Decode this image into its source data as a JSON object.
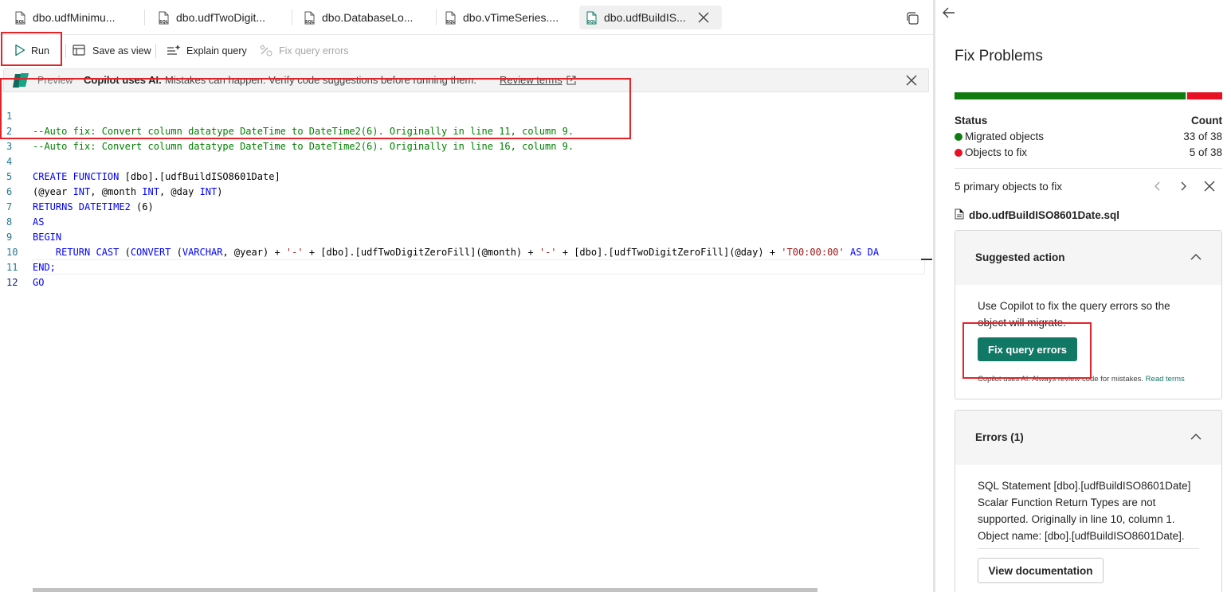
{
  "tabs": [
    {
      "label": "dbo.udfMinimu...",
      "active": false
    },
    {
      "label": "dbo.udfTwoDigit...",
      "active": false
    },
    {
      "label": "dbo.DatabaseLo...",
      "active": false
    },
    {
      "label": "dbo.vTimeSeries....",
      "active": false
    },
    {
      "label": "dbo.udfBuildIS...",
      "active": true
    }
  ],
  "toolbar": {
    "run": "Run",
    "save_as_view": "Save as view",
    "explain_query": "Explain query",
    "fix_query_errors": "Fix query errors"
  },
  "banner": {
    "preview": "Preview",
    "bold": "Copilot uses AI.",
    "message": "Mistakes can happen. Verify code suggestions before running them.",
    "link": "Review terms"
  },
  "code": {
    "line_numbers": [
      "1",
      "2",
      "3",
      "4",
      "5",
      "6",
      "7",
      "8",
      "9",
      "10",
      "11",
      "12"
    ],
    "l1": "--Auto fix: Convert column datatype DateTime to DateTime2(6). Originally in line 11, column 9.",
    "l2": "--Auto fix: Convert column datatype DateTime to DateTime2(6). Originally in line 16, column 9.",
    "l4a": "CREATE FUNCTION",
    "l4b": " [dbo].[udfBuildISO8601Date]",
    "l5a": "(@year ",
    "l5b": "INT",
    "l5c": ", @month ",
    "l5d": "INT",
    "l5e": ", @day ",
    "l5f": "INT",
    "l5g": ")",
    "l6a": "RETURNS DATETIME2",
    "l6b": " (6)",
    "l7": "AS",
    "l8": "BEGIN",
    "l9a": "    RETURN CAST",
    "l9b": " (",
    "l9c": "CONVERT",
    "l9d": " (",
    "l9e": "VARCHAR",
    "l9f": ", @year) + ",
    "l9g": "'-'",
    "l9h": " + [dbo].[udfTwoDigitZeroFill](@month) + ",
    "l9i": "'-'",
    "l9j": " + [dbo].[udfTwoDigitZeroFill](@day) + ",
    "l9k": "'T00:00:00'",
    "l9l": " AS DA",
    "l10": "END;",
    "l11": "GO"
  },
  "panel": {
    "title": "Fix Problems",
    "progress": {
      "migrated": 33,
      "total": 38,
      "to_fix": 5
    },
    "status_header": "Status",
    "count_header": "Count",
    "migrated_label": "Migrated objects",
    "migrated_count": "33 of 38",
    "tofix_label": "Objects to fix",
    "tofix_count": "5 of 38",
    "primary_objects": "5 primary objects to fix",
    "filename": "dbo.udfBuildISO8601Date.sql",
    "suggested_title": "Suggested action",
    "suggested_text_1": "Use Copilot to fix the query errors so the",
    "suggested_text_2": "object will migrate.",
    "fix_button": "Fix query errors",
    "disclaimer": "Copilot uses AI. Always review code for mistakes.",
    "read_terms": "Read terms",
    "errors_title": "Errors (1)",
    "error_lines": [
      "SQL Statement [dbo].[udfBuildISO8601Date]",
      "Scalar Function Return Types are not",
      "supported. Originally in line 10, column 1.",
      "Object name: [dbo].[udfBuildISO8601Date]."
    ],
    "doc_button": "View documentation"
  },
  "colors": {
    "green": "#107c10",
    "red": "#e81123",
    "accent": "#117865",
    "highlight": "#e2242a"
  }
}
